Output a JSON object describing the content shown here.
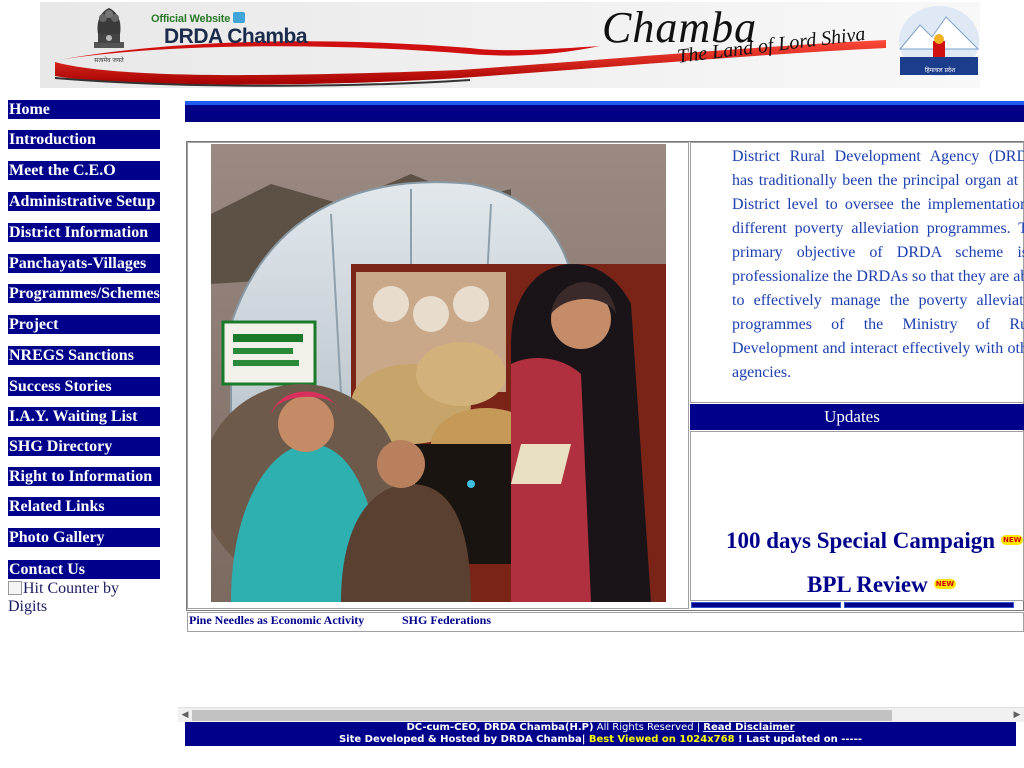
{
  "header": {
    "official_label": "Official Website",
    "site_title": "DRDA Chamba",
    "place_name": "Chamba",
    "tagline": "The Land of Lord Shiva",
    "emblem_caption": "सत्यमेव जयते",
    "hp_caption": "हिमाचल प्रदेश"
  },
  "nav": {
    "items": [
      "Home",
      "Introduction",
      "Meet the C.E.O",
      "Administrative Setup",
      "District Information",
      "Panchayats-Villages",
      "Programmes/Schemes",
      "Project",
      "NREGS Sanctions",
      "Success Stories",
      "I.A.Y. Waiting List",
      "SHG Directory",
      "Right to Information",
      "Related Links",
      "Photo Gallery",
      "Contact Us"
    ],
    "counter_alt": "Hit Counter by Digits"
  },
  "intro": {
    "lines": [
      "District Rural Development Agency (DRD",
      "has traditionally been the principal organ at t",
      "District level to oversee the implementation",
      "different poverty alleviation programmes. T",
      "primary objective of DRDA scheme is",
      "professionalize the DRDAs so that they are ab",
      "to effectively manage the poverty alleviati",
      "programmes of the Ministry of Ru",
      "Development and interact effectively with oth",
      "agencies."
    ]
  },
  "updates": {
    "heading": "Updates",
    "items": [
      "100 days Special Campaign",
      "BPL Review"
    ],
    "badge": "NEW"
  },
  "sublinks": [
    "Pine Needles as Economic Activity",
    "SHG Federations"
  ],
  "footer": {
    "line1_owner": "DC-cum-CEO, DRDA Chamba(H.P)",
    "line1_rights": " All Rights Reserved | ",
    "line1_disclaimer": "Read Disclaimer",
    "line2_hosted": "Site Developed & Hosted by DRDA Chamba",
    "line2_sep": "| ",
    "line2_best": "Best Viewed on 1024x768",
    "line2_updated": " ! Last updated on -----"
  },
  "colors": {
    "nav_bg": "#00008b",
    "intro_text": "#1c3fb0",
    "footer_bg": "#00008b",
    "highlight": "#ffff00"
  }
}
